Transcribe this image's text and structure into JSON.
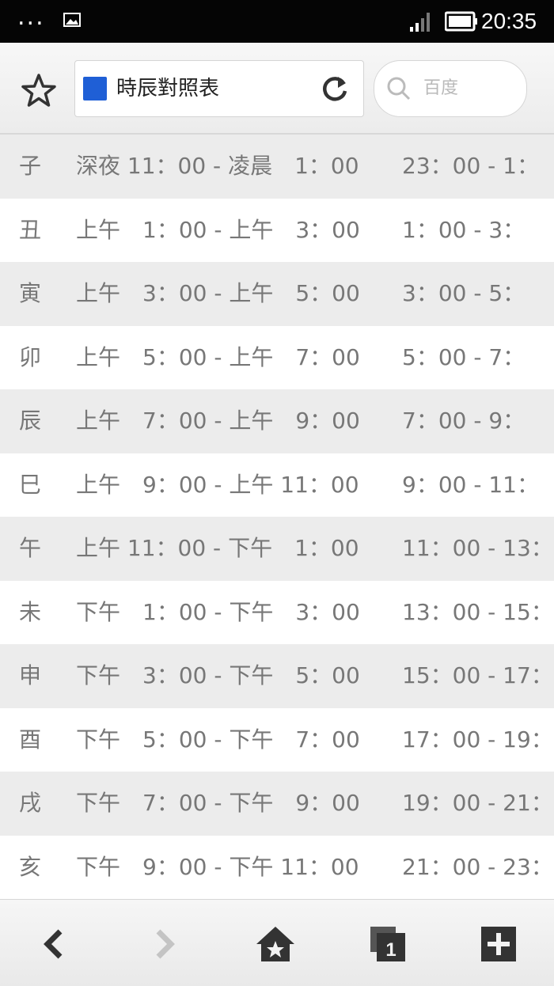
{
  "status_bar": {
    "dots": "...",
    "time": "20:35"
  },
  "address_bar": {
    "page_title": "時辰對照表",
    "search_placeholder": "百度"
  },
  "table": {
    "rows": [
      {
        "name": "子",
        "range": "深夜 11：00 - 凌晨　1：00",
        "range24": "23：00 - 1："
      },
      {
        "name": "丑",
        "range": "上午　1：00 - 上午　3：00",
        "range24": "1：00 - 3："
      },
      {
        "name": "寅",
        "range": "上午　3：00 - 上午　5：00",
        "range24": "3：00 - 5："
      },
      {
        "name": "卯",
        "range": "上午　5：00 - 上午　7：00",
        "range24": "5：00 - 7："
      },
      {
        "name": "辰",
        "range": "上午　7：00 - 上午　9：00",
        "range24": "7：00 - 9："
      },
      {
        "name": "巳",
        "range": "上午　9：00 - 上午 11：00",
        "range24": "9：00 - 11："
      },
      {
        "name": "午",
        "range": "上午 11：00 - 下午　1：00",
        "range24": "11：00 - 13："
      },
      {
        "name": "未",
        "range": "下午　1：00 - 下午　3：00",
        "range24": "13：00 - 15："
      },
      {
        "name": "申",
        "range": "下午　3：00 - 下午　5：00",
        "range24": "15：00 - 17："
      },
      {
        "name": "酉",
        "range": "下午　5：00 - 下午　7：00",
        "range24": "17：00 - 19："
      },
      {
        "name": "戌",
        "range": "下午　7：00 - 下午　9：00",
        "range24": "19：00 - 21："
      },
      {
        "name": "亥",
        "range": "下午　9：00 - 下午 11：00",
        "range24": "21：00 - 23："
      }
    ]
  },
  "toolbar": {
    "icons": [
      "back-icon",
      "forward-icon",
      "home-icon",
      "tabs-icon",
      "new-tab-icon"
    ]
  },
  "colors": {
    "status_bar_bg": "#050505",
    "row_alt_bg": "#ececec",
    "text": "#777777",
    "favicon": "#1f5fd6"
  }
}
